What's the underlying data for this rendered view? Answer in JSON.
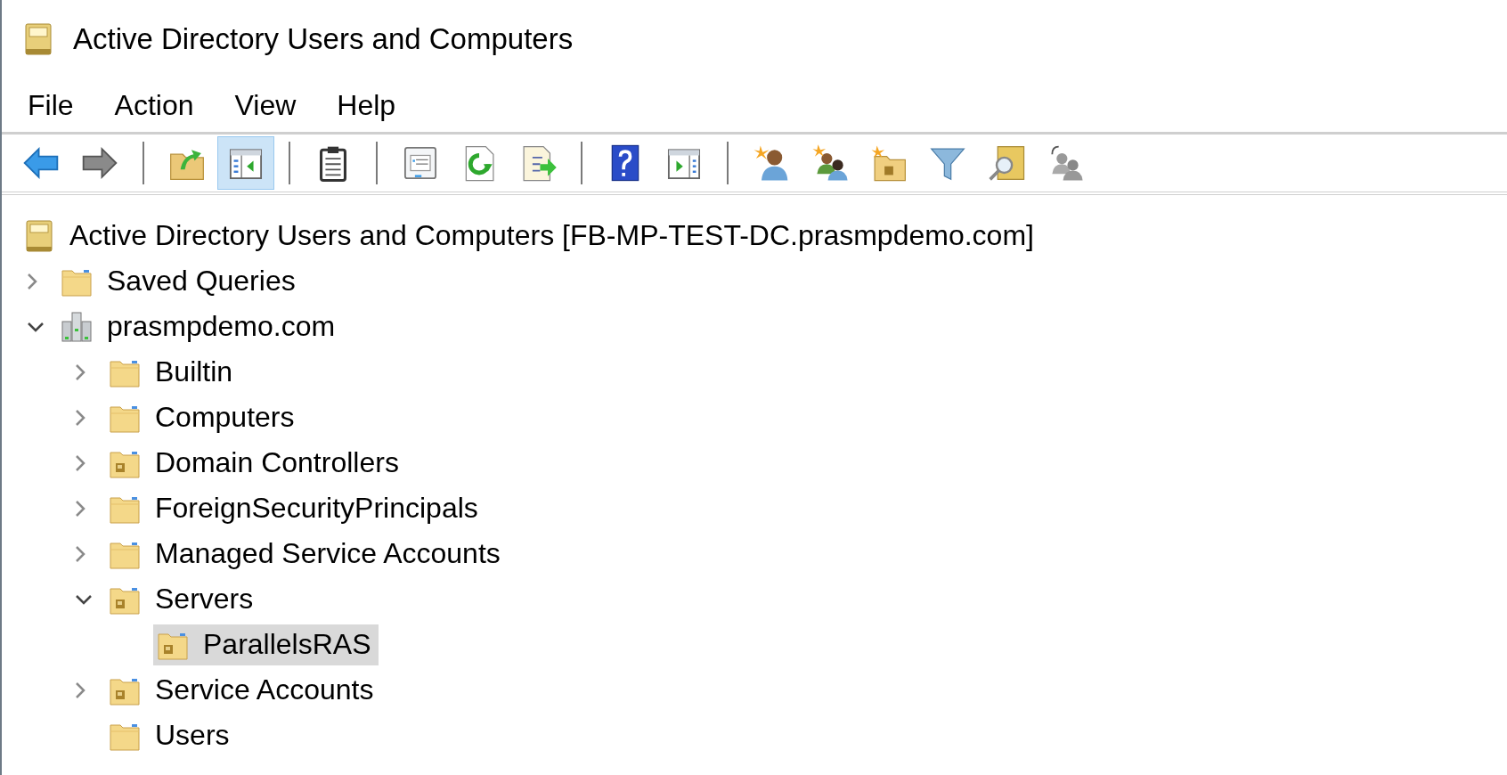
{
  "window": {
    "title": "Active Directory Users and Computers"
  },
  "menu": [
    "File",
    "Action",
    "View",
    "Help"
  ],
  "toolbar": [
    {
      "kind": "back",
      "selected": false
    },
    {
      "kind": "forward",
      "selected": false
    },
    {
      "kind": "separator"
    },
    {
      "kind": "up",
      "selected": false
    },
    {
      "kind": "tree-toggle",
      "selected": true
    },
    {
      "kind": "separator"
    },
    {
      "kind": "clipboard",
      "selected": false
    },
    {
      "kind": "separator"
    },
    {
      "kind": "properties",
      "selected": false
    },
    {
      "kind": "refresh",
      "selected": false
    },
    {
      "kind": "export",
      "selected": false
    },
    {
      "kind": "separator"
    },
    {
      "kind": "help",
      "selected": false
    },
    {
      "kind": "action-pane",
      "selected": false
    },
    {
      "kind": "separator"
    },
    {
      "kind": "new-user",
      "selected": false
    },
    {
      "kind": "new-group",
      "selected": false
    },
    {
      "kind": "new-ou",
      "selected": false
    },
    {
      "kind": "filter",
      "selected": false
    },
    {
      "kind": "find",
      "selected": false
    },
    {
      "kind": "delegate",
      "selected": false
    }
  ],
  "tree": [
    {
      "label": "Active Directory Users and Computers [FB-MP-TEST-DC.prasmpdemo.com]",
      "kind": "console",
      "selected": false,
      "children": [
        {
          "label": "Saved Queries",
          "kind": "folder",
          "expanded": false,
          "selected": false
        },
        {
          "label": "prasmpdemo.com",
          "kind": "domain",
          "expanded": true,
          "selected": false,
          "children": [
            {
              "label": "Builtin",
              "kind": "folder",
              "expanded": false,
              "selected": false
            },
            {
              "label": "Computers",
              "kind": "folder",
              "expanded": false,
              "selected": false
            },
            {
              "label": "Domain Controllers",
              "kind": "ou",
              "expanded": false,
              "selected": false
            },
            {
              "label": "ForeignSecurityPrincipals",
              "kind": "folder",
              "expanded": false,
              "selected": false
            },
            {
              "label": "Managed Service Accounts",
              "kind": "folder",
              "expanded": false,
              "selected": false
            },
            {
              "label": "Servers",
              "kind": "ou",
              "expanded": true,
              "selected": false,
              "children": [
                {
                  "label": "ParallelsRAS",
                  "kind": "ou",
                  "selected": true
                }
              ]
            },
            {
              "label": "Service Accounts",
              "kind": "ou",
              "expanded": false,
              "selected": false
            },
            {
              "label": "Users",
              "kind": "folder",
              "selected": false
            }
          ]
        }
      ]
    }
  ]
}
